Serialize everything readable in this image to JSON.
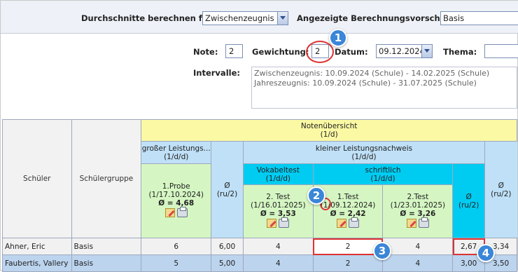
{
  "top": {
    "calc_label": "Durchschnitte berechnen für:",
    "calc_value": "Zwischenzeugnis",
    "rule_label": "Angezeigte Berechnungsvorschrift:",
    "rule_value": "Basis"
  },
  "form": {
    "note_label": "Note:",
    "note_value": "2",
    "weight_label": "Gewichtung:",
    "weight_value": "2",
    "date_label": "Datum:",
    "date_value": "09.12.2024",
    "topic_label": "Thema:",
    "topic_value": "",
    "intervals_label": "Intervalle:",
    "intervals": [
      "Zwischenzeugnis: 10.09.2024 (Schule) - 14.02.2025 (Schule)",
      "Jahreszeugnis: 10.09.2024 (Schule) - 31.07.2025 (Schule)"
    ]
  },
  "grid": {
    "head_overview": "Notenübersicht",
    "head_overview_sub": "(1/d)",
    "col_student": "Schüler",
    "col_group": "Schülergruppe",
    "big_group": "großer Leistungs...",
    "big_group_sub": "(1/d/d)",
    "small_group": "kleiner Leistungsnachweis",
    "small_group_sub": "(1/d/d)",
    "vokabeltest": "Vokabeltest",
    "vokabeltest_sub": "(1/d/d)",
    "schriftlich": "schriftlich",
    "schriftlich_sub": "(1/d/d)",
    "avg": "Ø",
    "avg_sub": "(ru/2)",
    "avg2": "Ø",
    "avg2_sub": "(ru/2)",
    "avg3": "Ø",
    "avg3_sub": "(ru/2)",
    "probe_title": "1.Probe",
    "probe_sub": "(1/17.10.2024)",
    "probe_avg": "Ø = 4,68",
    "test2_title": "2. Test",
    "test2_sub": "(1/16.01.2025)",
    "test2_avg": "Ø = 3,53",
    "test1_title": "1.Test",
    "test1_sub": "(1/09.12.2024)",
    "test1_avg": "Ø = 2,42",
    "test2b_title": "2.Test",
    "test2b_sub": "(1/23.01.2025)",
    "test2b_avg": "Ø = 3,26"
  },
  "rows": [
    {
      "name": "Ahner, Eric",
      "group": "Basis",
      "probe": "6",
      "avg1": "6,00",
      "test2": "4",
      "test1": "2",
      "test2b": "4",
      "avg2": "2,67",
      "avg3": "3,34"
    },
    {
      "name": "Faubertis, Vallery",
      "group": "Basis",
      "probe": "5",
      "avg1": "5,00",
      "test2": "4",
      "test1": "2",
      "test2b": "4",
      "avg2": "3,00",
      "avg3": "3,50"
    }
  ],
  "badges": [
    "1",
    "2",
    "3",
    "4"
  ],
  "colors": {
    "accent_blue": "#3a86d8",
    "highlight_red": "#d33333",
    "cyan": "#00ccf2",
    "yellow": "#fbf9a4"
  }
}
